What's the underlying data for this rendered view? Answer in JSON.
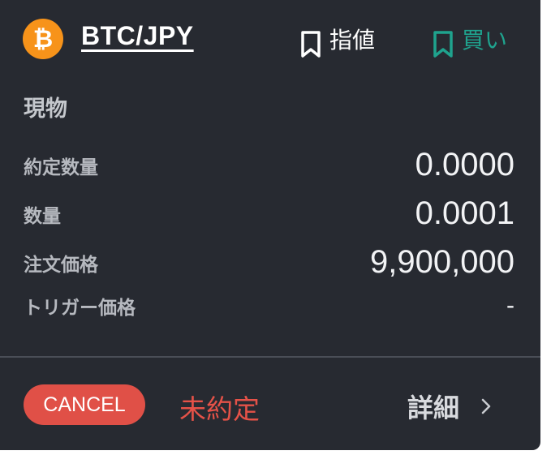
{
  "header": {
    "coin_symbol": "₿",
    "pair": "BTC/JPY",
    "order_type": "指値",
    "side": "買い"
  },
  "section_title": "現物",
  "rows": [
    {
      "label": "約定数量",
      "value": "0.0000"
    },
    {
      "label": "数量",
      "value": "0.0001"
    },
    {
      "label": "注文価格",
      "value": "9,900,000"
    },
    {
      "label": "トリガー価格",
      "value": "-"
    }
  ],
  "footer": {
    "cancel_label": "CANCEL",
    "status": "未約定",
    "detail_label": "詳細"
  },
  "colors": {
    "background": "#272a31",
    "bitcoin_orange": "#f7931a",
    "buy_green": "#1fa38e",
    "cancel_red": "#e05047"
  },
  "icons": {
    "coin": "bitcoin-icon",
    "order_type": "bookmark-icon",
    "side": "bookmark-icon",
    "detail": "chevron-right-icon"
  }
}
